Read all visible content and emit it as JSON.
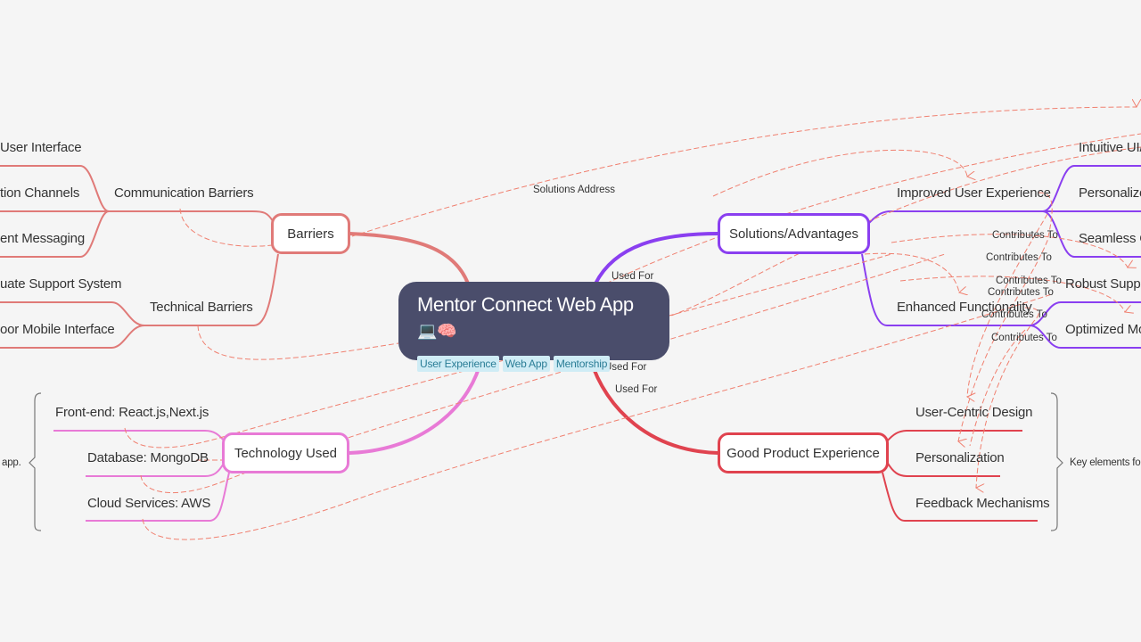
{
  "root": {
    "title": "Mentor Connect Web App",
    "emoji": "💻🧠",
    "tags": [
      "User Experience",
      "Web App",
      "Mentorship"
    ]
  },
  "colors": {
    "background": "#f5f5f5",
    "root": "#4a4d6b",
    "tag_bg": "#cfecf5",
    "tag_text": "#2a7d96",
    "barriers": "#e07a78",
    "solutions": "#8a3ff0",
    "technology": "#e87ad6",
    "good_product": "#e0434f",
    "relation": "#f08070"
  },
  "branches": {
    "barriers": {
      "label": "Barriers",
      "groups": [
        {
          "label": "Communication Barriers",
          "children": [
            "User Interface",
            "tion Channels",
            "ent Messaging"
          ]
        },
        {
          "label": "Technical Barriers",
          "children": [
            "uate Support System",
            "oor Mobile Interface"
          ]
        }
      ]
    },
    "solutions": {
      "label": "Solutions/Advantages",
      "groups": [
        {
          "label": "Improved User Experience",
          "children": [
            "Intuitive UI/",
            "Personalize",
            "Seamless Co"
          ]
        },
        {
          "label": "Enhanced Functionality",
          "children": [
            "Robust Suppo",
            "Optimized Mo"
          ]
        }
      ]
    },
    "technology": {
      "label": "Technology Used",
      "children": [
        "Front-end: React.js,Next.js",
        "Database: MongoDB",
        "Cloud Services: AWS"
      ],
      "summary": "app."
    },
    "good_product": {
      "label": "Good Product Experience",
      "children": [
        "User-Centric Design",
        "Personalization",
        "Feedback Mechanisms"
      ],
      "summary": "Key elements fo"
    }
  },
  "relations": {
    "solutions_address": "Solutions Address",
    "used_for": "Used For",
    "contributes_to": "Contributes To"
  }
}
